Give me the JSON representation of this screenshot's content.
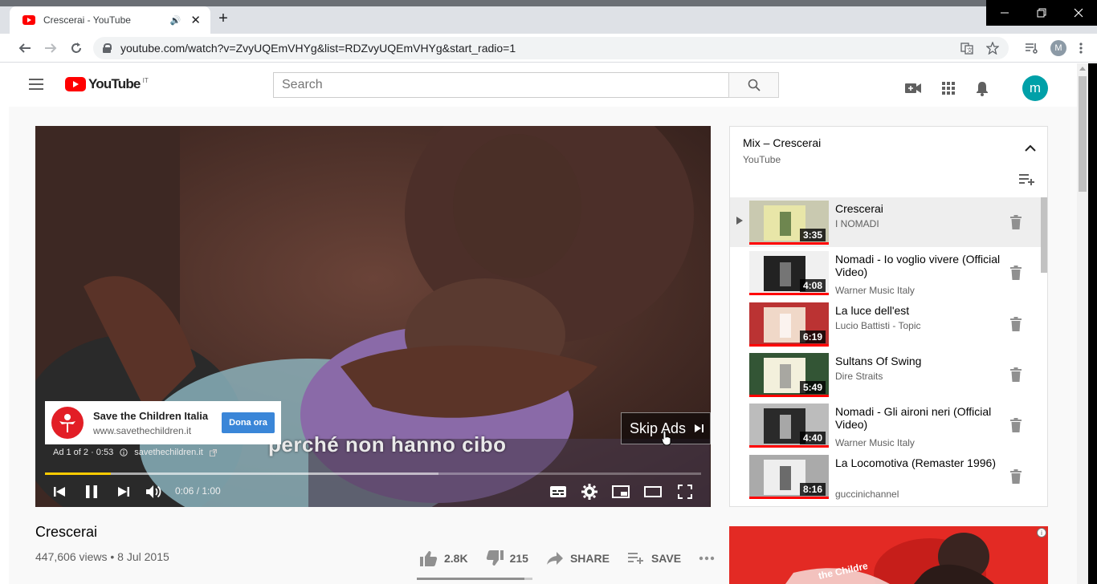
{
  "browser": {
    "tab_title": "Crescerai - YouTube",
    "audio_icon": "🔊",
    "url": "youtube.com/watch?v=ZvyUQEmVHYg&list=RDZvyUQEmVHYg&start_radio=1",
    "profile_initial": "M"
  },
  "youtube": {
    "logo_text": "YouTube",
    "logo_country": "IT",
    "search_placeholder": "Search",
    "avatar_initial": "m"
  },
  "player": {
    "subtitle": "perché non hanno cibo",
    "ad": {
      "advertiser": "Save the Children Italia",
      "url": "www.savethechildren.it",
      "cta": "Dona ora",
      "counter": "Ad 1 of 2 · 0:53",
      "link": "savethechildren.it"
    },
    "skip_label": "Skip Ads",
    "time": "0:06 / 1:00",
    "progress": 0.1,
    "buffered": 0.6
  },
  "video": {
    "title": "Crescerai",
    "meta": "447,606 views • 8 Jul 2015",
    "likes": "2.8K",
    "dislikes": "215",
    "share_label": "SHARE",
    "save_label": "SAVE",
    "like_ratio": 0.93
  },
  "playlist": {
    "title": "Mix – Crescerai",
    "subtitle": "YouTube",
    "items": [
      {
        "title": "Crescerai",
        "artist": "I NOMADI",
        "duration": "3:35",
        "playing": true
      },
      {
        "title": "Nomadi - Io voglio vivere (Official Video)",
        "artist": "Warner Music Italy",
        "duration": "4:08"
      },
      {
        "title": "La luce dell'est",
        "artist": "Lucio Battisti - Topic",
        "duration": "6:19"
      },
      {
        "title": "Sultans Of Swing",
        "artist": "Dire Straits",
        "duration": "5:49"
      },
      {
        "title": "Nomadi - Gli aironi neri (Official Video)",
        "artist": "Warner Music Italy",
        "duration": "4:40"
      },
      {
        "title": "La Locomotiva (Remaster 1996)",
        "artist": "guccinichannel",
        "duration": "8:16"
      }
    ]
  },
  "colors": {
    "youtube_red": "#ff0000",
    "accent_teal": "#00a0a8",
    "progress_yellow": "#ffcc00",
    "cta_blue": "#3a86d8"
  }
}
